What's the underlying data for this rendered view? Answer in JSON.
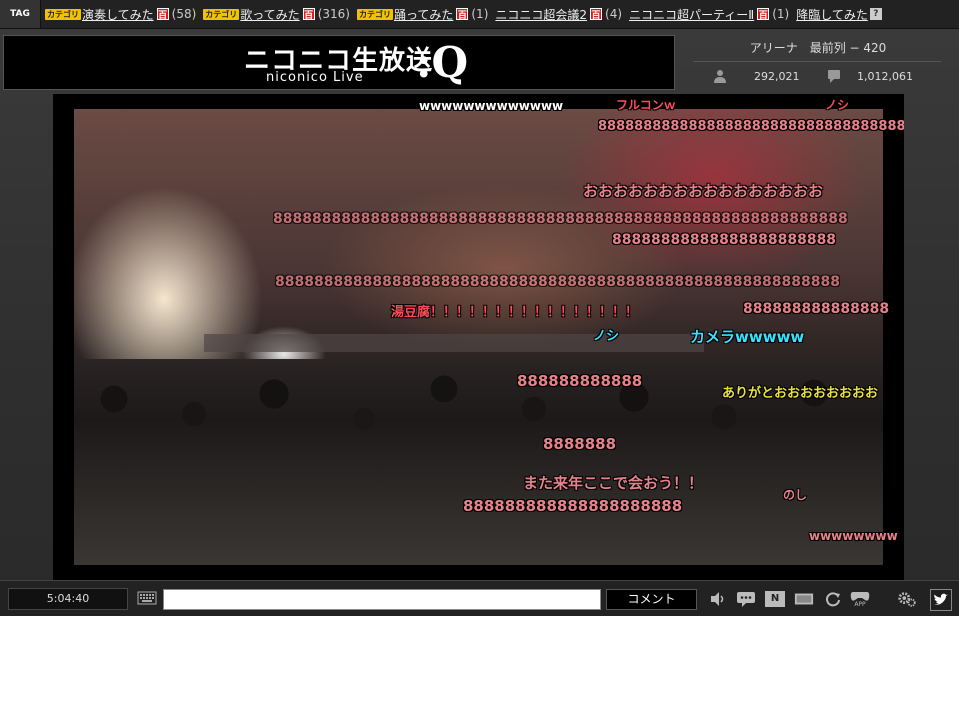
{
  "tagbar": {
    "tag_label": "TAG",
    "category_badge": "カテゴリ",
    "dict_badge": "百",
    "help_badge": "?",
    "tags": [
      {
        "name": "演奏してみた",
        "category": true,
        "count": "(58)"
      },
      {
        "name": "歌ってみた",
        "category": true,
        "count": "(316)"
      },
      {
        "name": "踊ってみた",
        "category": true,
        "count": "(1)"
      },
      {
        "name": "ニコニコ超会議2",
        "category": false,
        "count": "(4)"
      },
      {
        "name": "ニコニコ超パーティーⅡ",
        "category": false,
        "count": "(1)"
      },
      {
        "name": "降臨してみた",
        "category": false,
        "count": ""
      }
    ]
  },
  "banner": {
    "logo_main": "ニコニコ生放送",
    "logo_sub": "niconico Live",
    "logo_suffix": ":Q"
  },
  "stats": {
    "seat": "アリーナ　最前列 − 420",
    "viewers": "292,021",
    "comments": "1,012,061",
    "viewers_icon": "person-icon",
    "comments_icon": "speech-bubble-icon"
  },
  "video": {
    "comments": [
      {
        "text": "wwwwwwwwwwwww",
        "color": "white"
      },
      {
        "text": "フルコンｗ",
        "color": "red"
      },
      {
        "text": "ノシ",
        "color": "red"
      },
      {
        "text": "8888888888888888888888888888888888888",
        "color": "pink"
      },
      {
        "text": "おおおおおおおおおおおおおおおお",
        "color": "pink"
      },
      {
        "text": "88888888888888888888888888888888888888888888888888888888888",
        "color": "pink"
      },
      {
        "text": "88888888888888888888888",
        "color": "pink"
      },
      {
        "text": "8888888888888888888888888888888888888888888888888888888888",
        "color": "pink"
      },
      {
        "text": "湯豆腐！！！！！！！！！！！！！！！！",
        "color": "red"
      },
      {
        "text": "888888888888888",
        "color": "pink"
      },
      {
        "text": "ノシ",
        "color": "cyan"
      },
      {
        "text": "カメラwwwww",
        "color": "cyan"
      },
      {
        "text": "888888888888",
        "color": "pink"
      },
      {
        "text": "ありがとおおおおおおおお",
        "color": "yellow"
      },
      {
        "text": "8888888",
        "color": "pink"
      },
      {
        "text": "また来年ここで会おう！！",
        "color": "pink"
      },
      {
        "text": "のし",
        "color": "pink"
      },
      {
        "text": "888888888888888888888",
        "color": "pink"
      },
      {
        "text": "wwwwwwww",
        "color": "pink"
      }
    ]
  },
  "controls": {
    "time": "5:04:40",
    "comment_placeholder": "",
    "comment_button": "コメント",
    "icons": [
      "keyboard-icon",
      "volume-icon",
      "comment-toggle-icon",
      "nicosound-icon",
      "screen-size-icon",
      "reload-icon",
      "app-gamepad-icon",
      "settings-gears-icon",
      "twitter-icon"
    ],
    "nicosound_label": "N",
    "app_label": "APP"
  }
}
